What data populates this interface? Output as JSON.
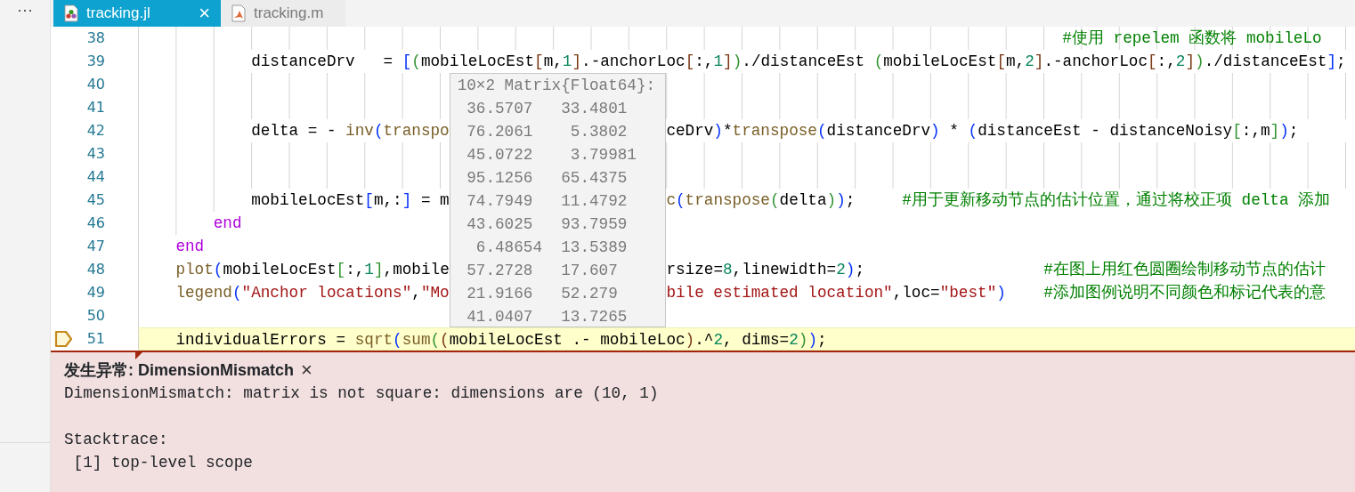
{
  "sidebar": {
    "more": "···"
  },
  "tabs": [
    {
      "label": "tracking.jl",
      "selected": true,
      "kind": "julia",
      "close": "×"
    },
    {
      "label": "tracking.m",
      "selected": false,
      "kind": "matlab"
    }
  ],
  "editor": {
    "lines": [
      {
        "number": "38",
        "current": false,
        "indent_guides": true,
        "left": [
          {
            "text": "                                                                                                  #使用 repelem 函数将 mobileLo",
            "kind": "comment"
          }
        ]
      },
      {
        "number": "39",
        "current": false,
        "indent_guides": false,
        "left": [
          {
            "text": "            distanceDrv   = ",
            "kind": "plain"
          },
          {
            "text": "[",
            "kind": "bracket1"
          },
          {
            "text": "(",
            "kind": "bracket2"
          },
          {
            "text": "mobileLocEst",
            "kind": "plain"
          },
          {
            "text": "[",
            "kind": "bracket3"
          },
          {
            "text": "m,",
            "kind": "plain"
          },
          {
            "text": "1",
            "kind": "number"
          },
          {
            "text": "]",
            "kind": "bracket3"
          },
          {
            "text": ".-anchorLoc",
            "kind": "plain"
          },
          {
            "text": "[",
            "kind": "bracket3"
          },
          {
            "text": ":,",
            "kind": "plain"
          },
          {
            "text": "1",
            "kind": "number"
          },
          {
            "text": "]",
            "kind": "bracket3"
          },
          {
            "text": ")",
            "kind": "bracket2"
          },
          {
            "text": "./distanceEst ",
            "kind": "plain"
          },
          {
            "text": "(",
            "kind": "bracket2"
          },
          {
            "text": "mobileLocEst",
            "kind": "plain"
          },
          {
            "text": "[",
            "kind": "bracket3"
          },
          {
            "text": "m,",
            "kind": "plain"
          },
          {
            "text": "2",
            "kind": "number"
          },
          {
            "text": "]",
            "kind": "bracket3"
          },
          {
            "text": ".-anchorLoc",
            "kind": "plain"
          },
          {
            "text": "[",
            "kind": "bracket3"
          },
          {
            "text": ":,",
            "kind": "plain"
          },
          {
            "text": "2",
            "kind": "number"
          },
          {
            "text": "]",
            "kind": "bracket3"
          },
          {
            "text": ")",
            "kind": "bracket2"
          },
          {
            "text": "./distanceEst",
            "kind": "plain"
          },
          {
            "text": "]",
            "kind": "bracket1"
          },
          {
            "text": ";",
            "kind": "plain"
          }
        ]
      },
      {
        "number": "40",
        "current": false,
        "indent_guides": true
      },
      {
        "number": "41",
        "current": false,
        "indent_guides": true
      },
      {
        "number": "42",
        "current": false,
        "indent_guides": false,
        "left": [
          {
            "text": "            delta = - ",
            "kind": "plain"
          },
          {
            "text": "inv",
            "kind": "function"
          },
          {
            "text": "(",
            "kind": "bracket1"
          },
          {
            "text": "transpo",
            "kind": "function"
          }
        ],
        "right": [
          {
            "text": "ceDrv",
            "kind": "plain"
          },
          {
            "text": ")",
            "kind": "bracket1"
          },
          {
            "text": "*",
            "kind": "plain"
          },
          {
            "text": "transpose",
            "kind": "function"
          },
          {
            "text": "(",
            "kind": "bracket1"
          },
          {
            "text": "distanceDrv",
            "kind": "plain"
          },
          {
            "text": ")",
            "kind": "bracket1"
          },
          {
            "text": " * ",
            "kind": "plain"
          },
          {
            "text": "(",
            "kind": "bracket1"
          },
          {
            "text": "distanceEst - distanceNoisy",
            "kind": "plain"
          },
          {
            "text": "[",
            "kind": "bracket2"
          },
          {
            "text": ":,m",
            "kind": "plain"
          },
          {
            "text": "]",
            "kind": "bracket2"
          },
          {
            "text": ")",
            "kind": "bracket1"
          },
          {
            "text": ";",
            "kind": "plain"
          }
        ]
      },
      {
        "number": "43",
        "current": false,
        "indent_guides": true
      },
      {
        "number": "44",
        "current": false,
        "indent_guides": true
      },
      {
        "number": "45",
        "current": false,
        "indent_guides": false,
        "left": [
          {
            "text": "            mobileLocEst",
            "kind": "plain"
          },
          {
            "text": "[",
            "kind": "bracket1"
          },
          {
            "text": "m,:",
            "kind": "plain"
          },
          {
            "text": "]",
            "kind": "bracket1"
          },
          {
            "text": " = m",
            "kind": "plain"
          }
        ],
        "right": [
          {
            "text": "c",
            "kind": "function"
          },
          {
            "text": "(",
            "kind": "bracket1"
          },
          {
            "text": "transpose",
            "kind": "function"
          },
          {
            "text": "(",
            "kind": "bracket2"
          },
          {
            "text": "delta",
            "kind": "plain"
          },
          {
            "text": ")",
            "kind": "bracket2"
          },
          {
            "text": ")",
            "kind": "bracket1"
          },
          {
            "text": ";     ",
            "kind": "plain"
          },
          {
            "text": "#用于更新移动节点的估计位置，通过将校正项 delta 添加",
            "kind": "comment"
          }
        ]
      },
      {
        "number": "46",
        "current": false,
        "indent_guides": false,
        "left": [
          {
            "text": "        end",
            "kind": "keyword"
          }
        ]
      },
      {
        "number": "47",
        "current": false,
        "indent_guides": false,
        "left": [
          {
            "text": "    end",
            "kind": "keyword"
          }
        ]
      },
      {
        "number": "48",
        "current": false,
        "indent_guides": false,
        "left": [
          {
            "text": "    plot",
            "kind": "function"
          },
          {
            "text": "(",
            "kind": "bracket1"
          },
          {
            "text": "mobileLocEst",
            "kind": "plain"
          },
          {
            "text": "[",
            "kind": "bracket2"
          },
          {
            "text": ":,",
            "kind": "plain"
          },
          {
            "text": "1",
            "kind": "number"
          },
          {
            "text": "]",
            "kind": "bracket2"
          },
          {
            "text": ",mobile",
            "kind": "plain"
          }
        ],
        "right": [
          {
            "text": "rsize=",
            "kind": "plain"
          },
          {
            "text": "8",
            "kind": "number"
          },
          {
            "text": ",linewidth=",
            "kind": "plain"
          },
          {
            "text": "2",
            "kind": "number"
          },
          {
            "text": ")",
            "kind": "bracket1"
          },
          {
            "text": ";                   ",
            "kind": "plain"
          },
          {
            "text": "#在图上用红色圆圈绘制移动节点的估计",
            "kind": "comment"
          }
        ]
      },
      {
        "number": "49",
        "current": false,
        "indent_guides": false,
        "left": [
          {
            "text": "    legend",
            "kind": "function"
          },
          {
            "text": "(",
            "kind": "bracket1"
          },
          {
            "text": "\"Anchor locations\"",
            "kind": "string"
          },
          {
            "text": ",",
            "kind": "plain"
          },
          {
            "text": "\"Mo",
            "kind": "string"
          }
        ],
        "right": [
          {
            "text": "bile estimated location\"",
            "kind": "string"
          },
          {
            "text": ",loc=",
            "kind": "plain"
          },
          {
            "text": "\"best\"",
            "kind": "string"
          },
          {
            "text": ")",
            "kind": "bracket1"
          },
          {
            "text": "    #添加图例说明不同颜色和标记代表的意",
            "kind": "comment"
          }
        ]
      },
      {
        "number": "50",
        "current": false,
        "indent_guides": false
      },
      {
        "number": "51",
        "current": true,
        "indent_guides": false,
        "left": [
          {
            "text": "    individualErrors = ",
            "kind": "plain"
          },
          {
            "text": "sqrt",
            "kind": "function"
          },
          {
            "text": "(",
            "kind": "bracket1"
          },
          {
            "text": "sum",
            "kind": "function"
          },
          {
            "text": "(",
            "kind": "bracket2"
          },
          {
            "text": "(",
            "kind": "bracket3"
          },
          {
            "text": "mobileLocEst .- mobileLoc",
            "kind": "plain"
          },
          {
            "text": ")",
            "kind": "bracket3"
          },
          {
            "text": ".^",
            "kind": "plain"
          },
          {
            "text": "2",
            "kind": "number"
          },
          {
            "text": ", dims=",
            "kind": "plain"
          },
          {
            "text": "2",
            "kind": "number"
          },
          {
            "text": ")",
            "kind": "bracket2"
          },
          {
            "text": ")",
            "kind": "bracket1"
          },
          {
            "text": ";",
            "kind": "plain"
          }
        ]
      }
    ],
    "hover": {
      "title": "10×2 Matrix{Float64}:",
      "rows": [
        [
          "36.5707",
          "33.4801"
        ],
        [
          "76.2061",
          "5.3802"
        ],
        [
          "45.0722",
          "3.79981"
        ],
        [
          "95.1256",
          "65.4375"
        ],
        [
          "74.7949",
          "11.4792"
        ],
        [
          "43.6025",
          "93.7959"
        ],
        [
          "6.48654",
          "13.5389"
        ],
        [
          "57.2728",
          "17.607"
        ],
        [
          "21.9166",
          "52.279"
        ],
        [
          "41.0407",
          "13.7265"
        ]
      ]
    }
  },
  "exception": {
    "title": "发生异常: DimensionMismatch",
    "close": "×",
    "message": "DimensionMismatch: matrix is not square: dimensions are (10, 1)",
    "stacktrace_label": "Stacktrace:",
    "frames": [
      " [1] top-level scope"
    ]
  }
}
